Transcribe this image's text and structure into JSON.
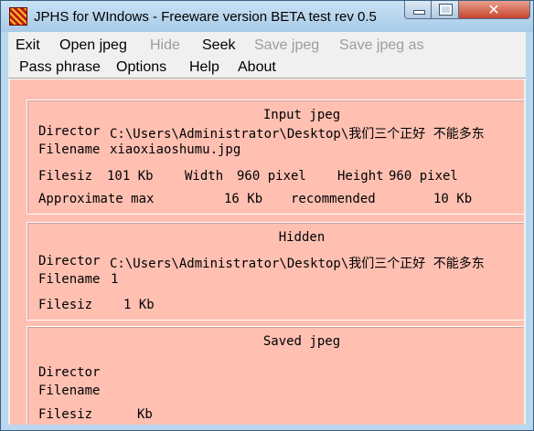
{
  "window": {
    "title": "JPHS for WIndows - Freeware version BETA test rev 0.5",
    "controls": {
      "minimize": "",
      "maximize": "",
      "close": "✕"
    }
  },
  "menu": {
    "row1": [
      {
        "label": "Exit",
        "enabled": true
      },
      {
        "label": "Open jpeg",
        "enabled": true
      },
      {
        "label": "Hide",
        "enabled": false
      },
      {
        "label": "Seek",
        "enabled": true
      },
      {
        "label": "Save jpeg",
        "enabled": false
      },
      {
        "label": "Save jpeg as",
        "enabled": false
      }
    ],
    "row2": [
      {
        "label": "Pass phrase",
        "enabled": true
      },
      {
        "label": "Options",
        "enabled": true
      },
      {
        "label": "Help",
        "enabled": true
      },
      {
        "label": "About",
        "enabled": true
      }
    ]
  },
  "input_jpeg": {
    "title": "Input jpeg",
    "directory_label": "Director",
    "directory_value": "C:\\Users\\Administrator\\Desktop\\我们三个正好 不能多东",
    "filename_label": "Filename",
    "filename_value": "xiaoxiaoshumu.jpg",
    "filesize_label": "Filesiz",
    "filesize_value": "101 Kb",
    "width_label": "Width",
    "width_value": "960 pixel",
    "height_label": "Height",
    "height_value": "960 pixel",
    "approx_label": "Approximate max",
    "approx_value": "16 Kb",
    "recommended_label": "recommended",
    "recommended_value": "10 Kb"
  },
  "hidden": {
    "title": "Hidden",
    "directory_label": "Director",
    "directory_value": "C:\\Users\\Administrator\\Desktop\\我们三个正好 不能多东",
    "filename_label": "Filename",
    "filename_value": "1",
    "filesize_label": "Filesiz",
    "filesize_value": "1 Kb"
  },
  "saved_jpeg": {
    "title": "Saved jpeg",
    "directory_label": "Director",
    "filename_label": "Filename",
    "filesize_label": "Filesiz",
    "filesize_value": "Kb"
  },
  "colors": {
    "content_bg": "#ffc0b2",
    "menu_bg": "#f0f0f0",
    "disabled_text": "#9d9d9d",
    "close_button": "#c7442c"
  },
  "icons": {
    "app": "jphs-app-icon"
  }
}
